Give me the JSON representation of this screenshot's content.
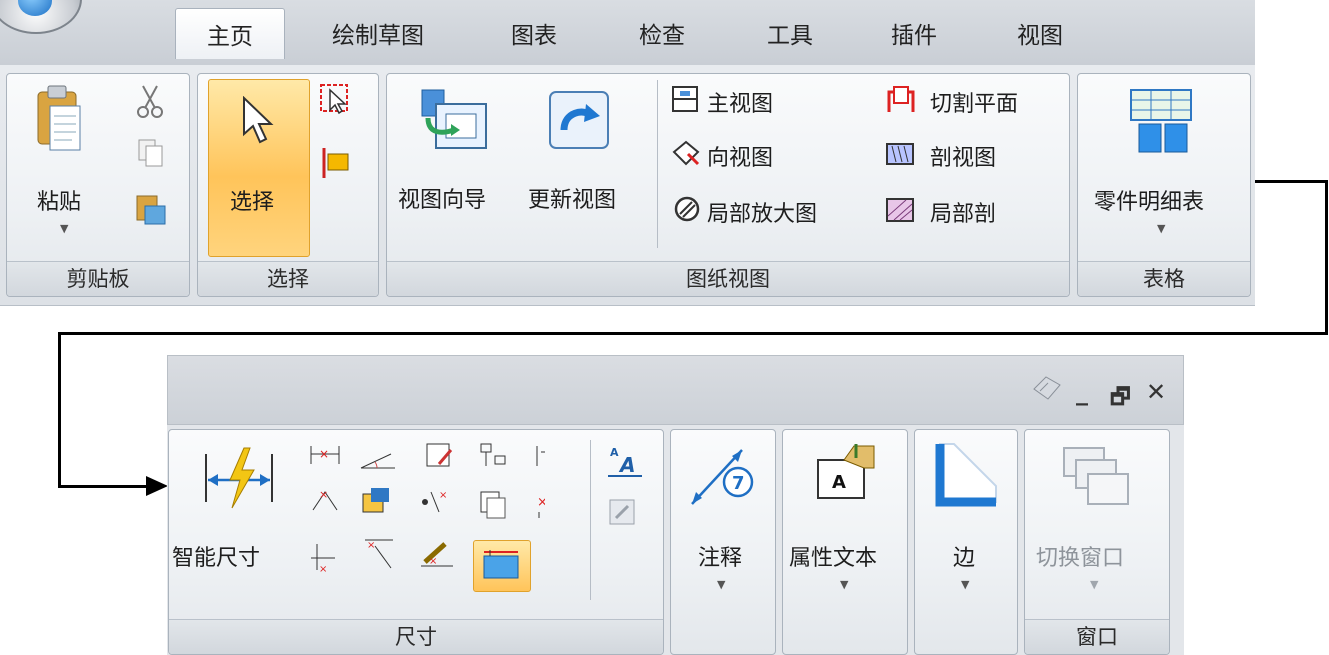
{
  "top_ribbon": {
    "tabs": [
      "主页",
      "绘制草图",
      "图表",
      "检查",
      "工具",
      "插件",
      "视图"
    ],
    "groups": {
      "clipboard": {
        "label": "剪贴板",
        "paste": "粘贴"
      },
      "select": {
        "label": "选择",
        "select_button": "选择"
      },
      "drawing_views": {
        "label": "图纸视图",
        "view_wizard": "视图向导",
        "update_views": "更新视图",
        "principal_view": "主视图",
        "auxiliary_view": "向视图",
        "detail_view": "局部放大图",
        "cutting_plane": "切割平面",
        "section_view": "剖视图",
        "broken_out_section": "局部剖"
      },
      "tables": {
        "label": "表格",
        "parts_list": "零件明细表"
      }
    }
  },
  "bottom_ribbon": {
    "window_controls": {
      "minimize": "_",
      "restore": "🗗",
      "close": "✕"
    },
    "groups": {
      "dimension": {
        "label": "尺寸",
        "smart_dimension": "智能尺寸"
      },
      "annotation": {
        "button": "注释"
      },
      "property_text": {
        "button": "属性文本"
      },
      "edge": {
        "button": "边"
      },
      "window": {
        "label": "窗口",
        "switch_window": "切换窗口"
      }
    }
  },
  "colors": {
    "accent_highlight": "#ffc45a",
    "connector": "#000000",
    "ribbon_bg": "#e3e6ea"
  }
}
